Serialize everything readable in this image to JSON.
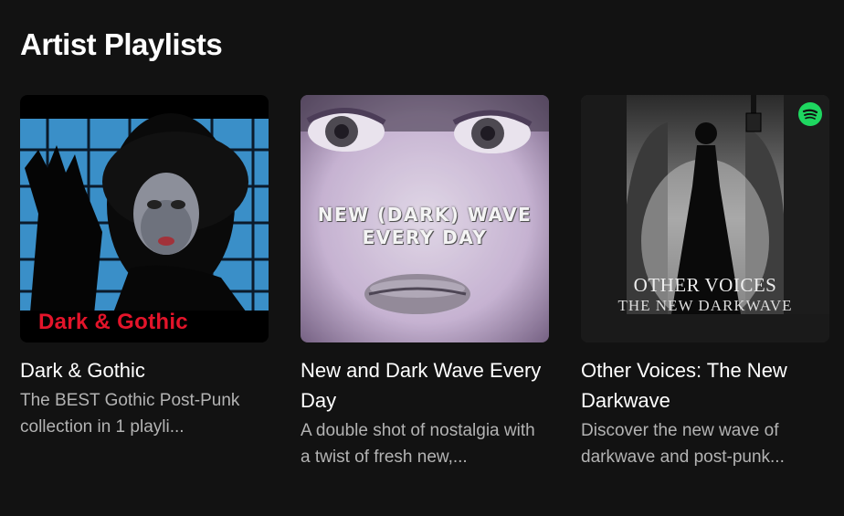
{
  "section": {
    "title": "Artist Playlists"
  },
  "playlists": [
    {
      "title": "Dark & Gothic",
      "description": "The BEST Gothic Post-Punk collection in 1 playli...",
      "cover_text": "Dark & Gothic",
      "cover_text_color": "#e3142a"
    },
    {
      "title": "New and Dark Wave Every Day",
      "description": "A double shot of nostalgia with a twist of fresh new,...",
      "cover_line1": "NEW (DARK) WAVE",
      "cover_line2": "EVERY DAY"
    },
    {
      "title": "Other Voices: The New Darkwave",
      "description": "Discover the new wave of darkwave and post-punk...",
      "cover_line1": "OTHER VOICES",
      "cover_line2": "THE NEW DARKWAVE",
      "badge_icon": "spotify-icon"
    }
  ],
  "colors": {
    "background": "#121212",
    "title_text": "#ffffff",
    "description_text": "#b3b3b3",
    "spotify_green": "#1ed760"
  }
}
